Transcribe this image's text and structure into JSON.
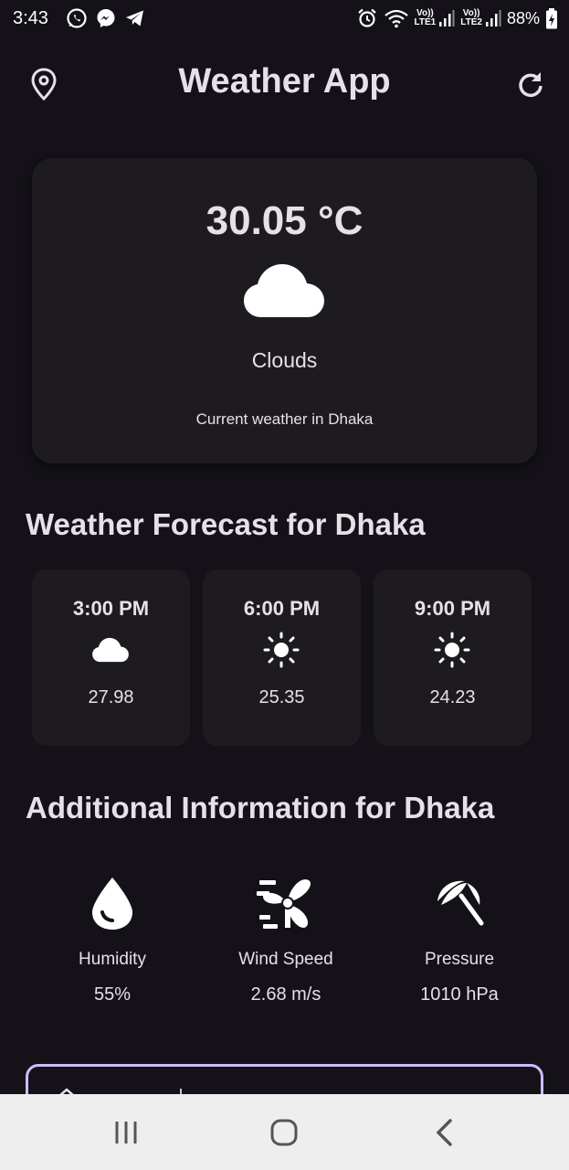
{
  "status_bar": {
    "time": "3:43",
    "battery": "88%",
    "sim1": "LTE1",
    "sim2": "LTE2",
    "volte": "Vo))"
  },
  "app_bar": {
    "title": "Weather App",
    "left_icon": "location-pin-icon",
    "right_icon": "refresh-icon"
  },
  "current": {
    "temperature": "30.05 °C",
    "icon": "cloud-icon",
    "condition": "Clouds",
    "caption": "Current weather in Dhaka"
  },
  "forecast": {
    "title": "Weather Forecast for Dhaka",
    "items": [
      {
        "time": "3:00 PM",
        "icon": "cloud-icon",
        "temp": "27.98"
      },
      {
        "time": "6:00 PM",
        "icon": "sun-icon",
        "temp": "25.35"
      },
      {
        "time": "9:00 PM",
        "icon": "sun-icon",
        "temp": "24.23"
      }
    ]
  },
  "additional": {
    "title": "Additional Information for Dhaka",
    "items": [
      {
        "icon": "water-drop-icon",
        "label": "Humidity",
        "value": "55%"
      },
      {
        "icon": "wind-fan-icon",
        "label": "Wind Speed",
        "value": "2.68 m/s"
      },
      {
        "icon": "beach-umbrella-icon",
        "label": "Pressure",
        "value": "1010 hPa"
      }
    ]
  },
  "colors": {
    "background": "#141218",
    "card": "#1d1b20",
    "text": "#e6e0e9",
    "accent": "#cfbcff",
    "nav_bar": "#eeeeee"
  }
}
